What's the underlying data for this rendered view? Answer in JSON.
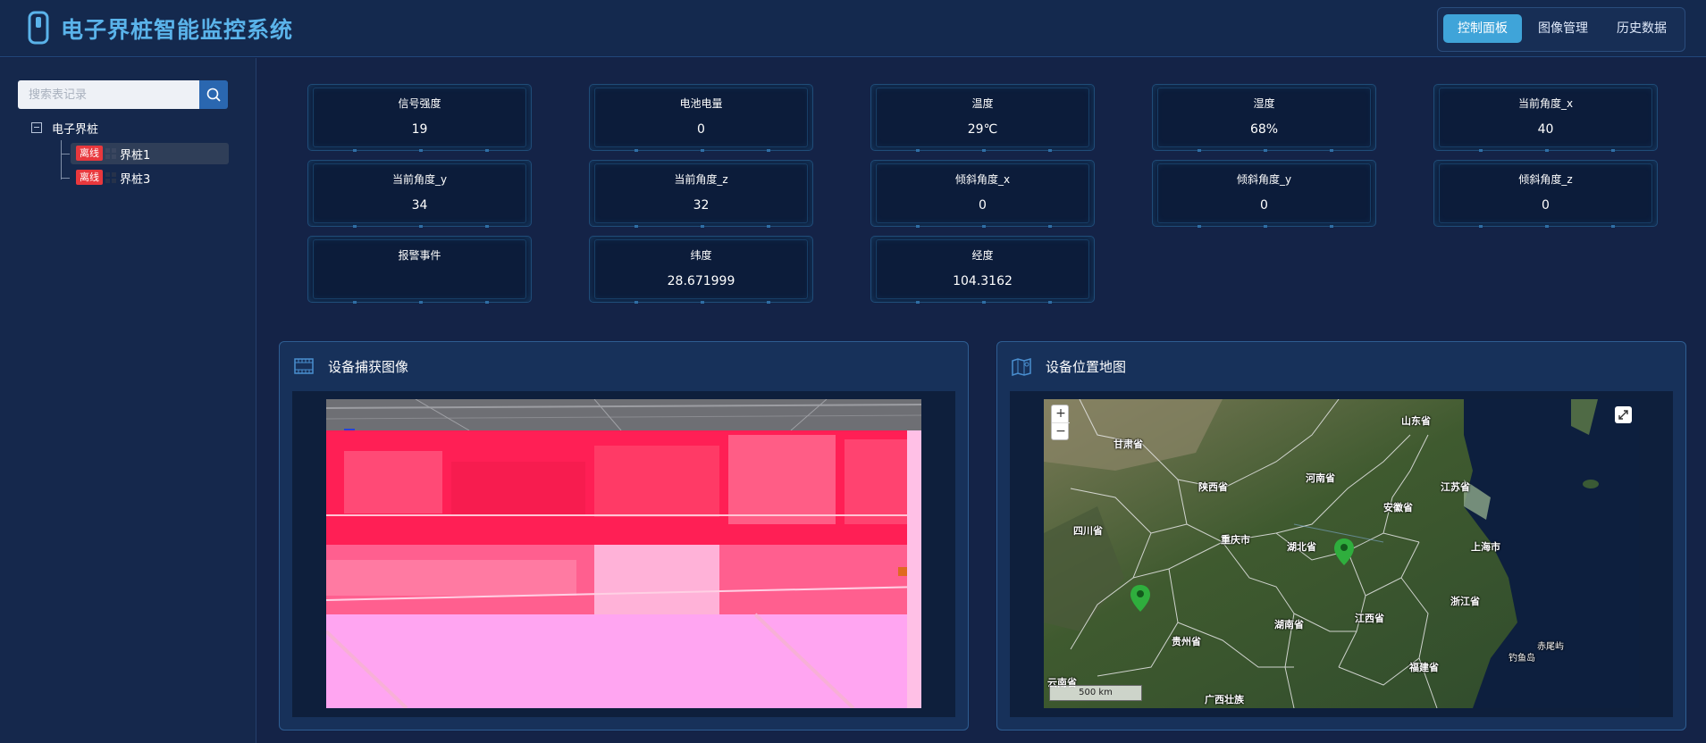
{
  "header": {
    "title": "电子界桩智能监控系统",
    "nav": [
      "控制面板",
      "图像管理",
      "历史数据"
    ],
    "accent": "#3fa4d9"
  },
  "sidebar": {
    "search_placeholder": "搜索表记录",
    "tree": {
      "root": "电子界桩",
      "items": [
        {
          "status": "离线",
          "name": "界桩1"
        },
        {
          "status": "离线",
          "name": "界桩3"
        }
      ]
    }
  },
  "metrics": [
    {
      "label": "信号强度",
      "value": "19"
    },
    {
      "label": "电池电量",
      "value": "0"
    },
    {
      "label": "温度",
      "value": "29℃"
    },
    {
      "label": "湿度",
      "value": "68%"
    },
    {
      "label": "当前角度_x",
      "value": "40"
    },
    {
      "label": "当前角度_y",
      "value": "34"
    },
    {
      "label": "当前角度_z",
      "value": "32"
    },
    {
      "label": "倾斜角度_x",
      "value": "0"
    },
    {
      "label": "倾斜角度_y",
      "value": "0"
    },
    {
      "label": "倾斜角度_z",
      "value": "0"
    },
    {
      "label": "报警事件",
      "value": ""
    },
    {
      "label": "纬度",
      "value": "28.671999"
    },
    {
      "label": "经度",
      "value": "104.3162"
    }
  ],
  "panels": {
    "image_title": "设备捕获图像",
    "map_title": "设备位置地图"
  },
  "map": {
    "zoom_in": "+",
    "zoom_out": "−",
    "scale": "500 km",
    "labels": {
      "shandong": "山东省",
      "gansu": "甘肃省",
      "henan": "河南省",
      "shaanxi": "陕西省",
      "jiangsu": "江苏省",
      "anhui": "安徽省",
      "sichuan": "四川省",
      "chongqing": "重庆市",
      "hubei": "湖北省",
      "shanghai": "上海市",
      "zhejiang": "浙江省",
      "guizhou": "贵州省",
      "hunan": "湖南省",
      "jiangxi": "江西省",
      "chiweiyu": "赤尾屿",
      "diaoyudao": "钓鱼岛",
      "fujian": "福建省",
      "yunnan": "云南省",
      "guangxi": "广西壮族"
    }
  }
}
